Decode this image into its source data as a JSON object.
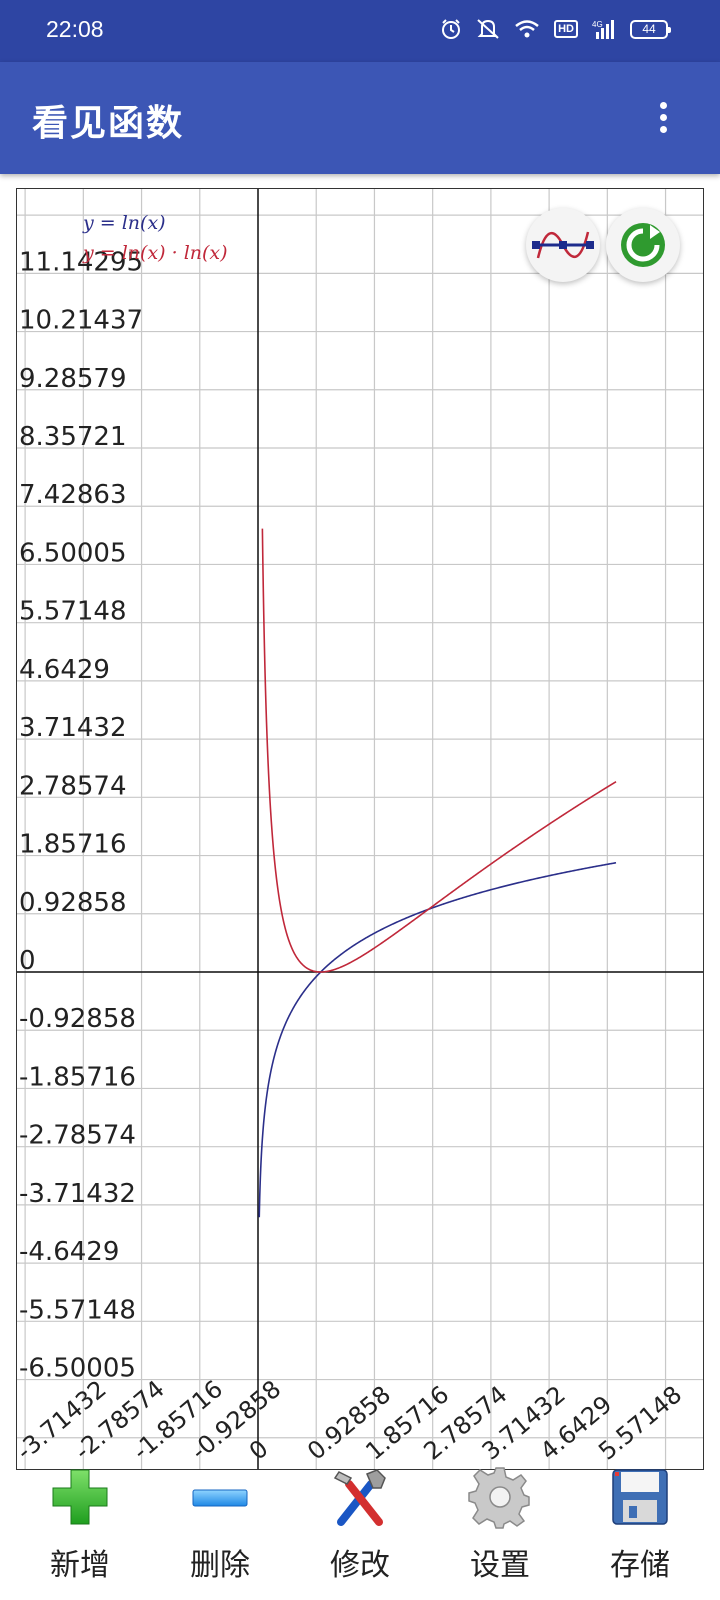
{
  "status_bar": {
    "time": "22:08",
    "battery": "44",
    "network": "4G",
    "hd": "HD"
  },
  "app_bar": {
    "title": "看见函数"
  },
  "graph": {
    "legend": [
      "y = ln(x)",
      "y = ln(x) · ln(x)"
    ],
    "y_tick_labels": [
      "11.14295",
      "10.21437",
      "9.28579",
      "8.35721",
      "7.42863",
      "6.50005",
      "5.57148",
      "4.6429",
      "3.71432",
      "2.78574",
      "1.85716",
      "0.92858",
      "0",
      "-0.92858",
      "-1.85716",
      "-2.78574",
      "-3.71432",
      "-4.6429",
      "-5.57148",
      "-6.50005"
    ],
    "x_tick_labels": [
      "-3.71432",
      "-2.78574",
      "-1.85716",
      "-0.92858",
      "0",
      "0.92858",
      "1.85716",
      "2.78574",
      "3.71432",
      "4.6429",
      "5.57148"
    ],
    "colors": {
      "series1": "#2b2f8a",
      "series2": "#c0283a",
      "grid": "#c8c8c8",
      "axis": "#111111"
    }
  },
  "chart_data": {
    "type": "line",
    "title": "",
    "xlabel": "",
    "ylabel": "",
    "xlim": [
      -3.71432,
      5.71
    ],
    "ylim": [
      -6.9,
      11.6
    ],
    "grid": true,
    "legend_position": "top-left",
    "series": [
      {
        "name": "y = ln(x)",
        "function": "ln(x)",
        "x": [
          0.02,
          0.05,
          0.1,
          0.2,
          0.3,
          0.5,
          0.75,
          1,
          1.5,
          2,
          3,
          4,
          5,
          5.71
        ],
        "y": [
          -3.91,
          -3.0,
          -2.3,
          -1.61,
          -1.2,
          -0.69,
          -0.29,
          0,
          0.41,
          0.69,
          1.1,
          1.39,
          1.61,
          1.74
        ]
      },
      {
        "name": "y = ln(x) · ln(x)",
        "function": "ln(x)*ln(x)",
        "x": [
          0.07,
          0.1,
          0.2,
          0.3,
          0.5,
          0.75,
          1,
          1.5,
          2,
          2.72,
          3,
          4,
          5,
          5.71
        ],
        "y": [
          7.07,
          5.3,
          2.59,
          1.45,
          0.48,
          0.08,
          0,
          0.16,
          0.48,
          1.0,
          1.21,
          1.92,
          2.59,
          3.04
        ]
      }
    ]
  },
  "toolbar": {
    "items": [
      {
        "label": "新增",
        "icon": "plus-icon"
      },
      {
        "label": "删除",
        "icon": "minus-icon"
      },
      {
        "label": "修改",
        "icon": "tools-icon"
      },
      {
        "label": "设置",
        "icon": "gear-icon"
      },
      {
        "label": "存储",
        "icon": "floppy-icon"
      }
    ]
  }
}
